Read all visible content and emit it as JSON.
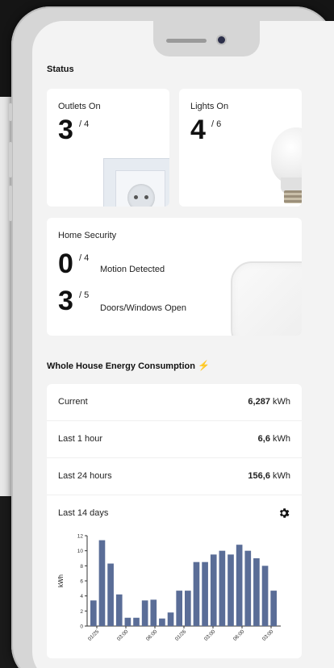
{
  "status": {
    "title": "Status",
    "outlets": {
      "label": "Outlets On",
      "on": "3",
      "total": "/ 4"
    },
    "lights": {
      "label": "Lights On",
      "on": "4",
      "total": "/ 6"
    }
  },
  "security": {
    "label": "Home Security",
    "motion": {
      "count": "0",
      "total": "/ 4",
      "text": "Motion Detected"
    },
    "doors": {
      "count": "3",
      "total": "/ 5",
      "text": "Doors/Windows Open"
    }
  },
  "energy": {
    "title": "Whole House Energy Consumption",
    "icon": "lightning-bolt-icon",
    "rows": [
      {
        "label": "Current",
        "value": "6,287",
        "unit": "kWh"
      },
      {
        "label": "Last 1 hour",
        "value": "6,6",
        "unit": "kWh"
      },
      {
        "label": "Last 24 hours",
        "value": "156,6",
        "unit": "kWh"
      }
    ],
    "last14": {
      "label": "Last 14 days",
      "settings_icon": "gear-icon"
    }
  },
  "chart_data": {
    "type": "bar",
    "ylabel": "kWh",
    "ylim": [
      0,
      12
    ],
    "yticks": [
      "0",
      "2",
      "4",
      "6",
      "8",
      "10",
      "12"
    ],
    "xticks": [
      "01/25",
      "03:00",
      "06:00",
      "01/26",
      "03:00",
      "06:00",
      "03:00"
    ],
    "values": [
      3.4,
      11.4,
      8.3,
      4.2,
      1.1,
      1.1,
      3.4,
      3.5,
      1.0,
      1.8,
      4.7,
      4.7,
      8.5,
      8.5,
      9.5,
      10.0,
      9.5,
      10.8,
      10.0,
      9.0,
      8.0,
      4.7
    ],
    "bar_color": "#5a6d97"
  },
  "colors": {
    "accent_bolt": "#f5c33b"
  }
}
